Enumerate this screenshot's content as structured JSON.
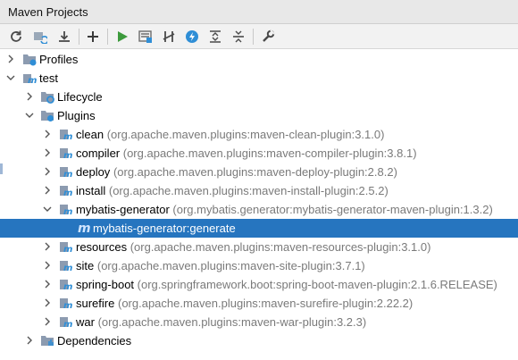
{
  "window": {
    "title": "Maven Projects"
  },
  "toolbar": {
    "buttons": [
      {
        "icon": "refresh-icon"
      },
      {
        "icon": "reimport-icon"
      },
      {
        "icon": "download-icon"
      },
      {
        "icon": "add-icon"
      },
      {
        "icon": "run-icon"
      },
      {
        "icon": "execute-goal-icon"
      },
      {
        "icon": "toggle-offline-icon"
      },
      {
        "icon": "skip-tests-icon"
      },
      {
        "icon": "expand-all-icon"
      },
      {
        "icon": "collapse-all-icon"
      },
      {
        "icon": "settings-wrench-icon"
      }
    ]
  },
  "tree": {
    "profiles": "Profiles",
    "project": "test",
    "lifecycle": "Lifecycle",
    "plugins_label": "Plugins",
    "plugins": [
      {
        "name": "clean",
        "coord": "(org.apache.maven.plugins:maven-clean-plugin:3.1.0)"
      },
      {
        "name": "compiler",
        "coord": "(org.apache.maven.plugins:maven-compiler-plugin:3.8.1)"
      },
      {
        "name": "deploy",
        "coord": "(org.apache.maven.plugins:maven-deploy-plugin:2.8.2)"
      },
      {
        "name": "install",
        "coord": "(org.apache.maven.plugins:maven-install-plugin:2.5.2)"
      },
      {
        "name": "mybatis-generator",
        "coord": "(org.mybatis.generator:mybatis-generator-maven-plugin:1.3.2)"
      },
      {
        "name": "resources",
        "coord": "(org.apache.maven.plugins:maven-resources-plugin:3.1.0)"
      },
      {
        "name": "site",
        "coord": "(org.apache.maven.plugins:maven-site-plugin:3.7.1)"
      },
      {
        "name": "spring-boot",
        "coord": "(org.springframework.boot:spring-boot-maven-plugin:2.1.6.RELEASE)"
      },
      {
        "name": "surefire",
        "coord": "(org.apache.maven.plugins:maven-surefire-plugin:2.22.2)"
      },
      {
        "name": "war",
        "coord": "(org.apache.maven.plugins:maven-war-plugin:3.2.3)"
      }
    ],
    "selected_goal": "mybatis-generator:generate",
    "dependencies": "Dependencies"
  },
  "colors": {
    "selection": "#2675bf",
    "coordinates": "#7a7a7a",
    "folder": "#8c9bb0",
    "accent": "#2f8ed6"
  }
}
